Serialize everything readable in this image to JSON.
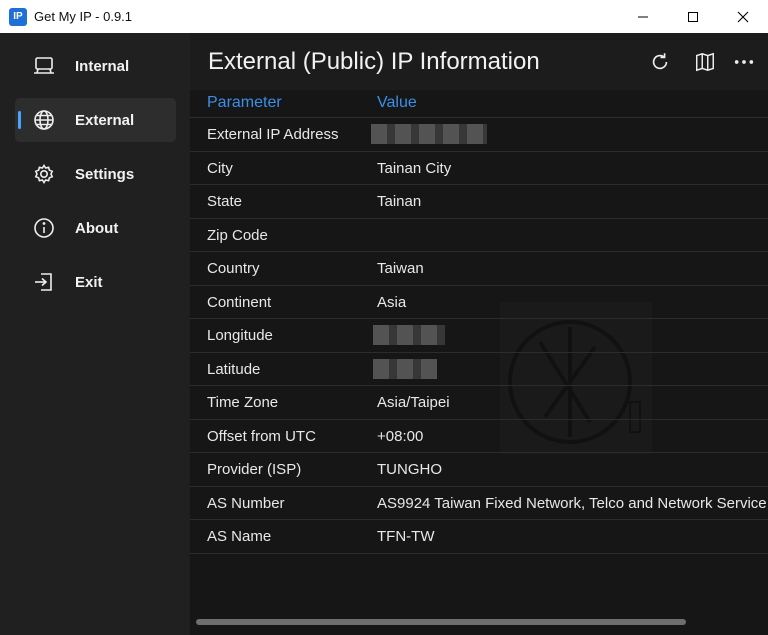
{
  "window": {
    "app_icon_text": "IP",
    "title": "Get My IP - 0.9.1"
  },
  "sidebar": {
    "items": [
      {
        "label": "Internal",
        "icon": "laptop-icon",
        "active": false
      },
      {
        "label": "External",
        "icon": "globe-icon",
        "active": true
      },
      {
        "label": "Settings",
        "icon": "gear-icon",
        "active": false
      },
      {
        "label": "About",
        "icon": "info-icon",
        "active": false
      },
      {
        "label": "Exit",
        "icon": "exit-icon",
        "active": false
      }
    ]
  },
  "main": {
    "title": "External (Public) IP Information",
    "header_icons": [
      "refresh-icon",
      "map-icon",
      "more-icon"
    ],
    "table": {
      "headers": [
        "Parameter",
        "Value"
      ],
      "rows": [
        {
          "param": "External IP Address",
          "value": ""
        },
        {
          "param": "City",
          "value": "Tainan City"
        },
        {
          "param": "State",
          "value": "Tainan"
        },
        {
          "param": "Zip Code",
          "value": ""
        },
        {
          "param": "Country",
          "value": "Taiwan"
        },
        {
          "param": "Continent",
          "value": "Asia"
        },
        {
          "param": "Longitude",
          "value": ""
        },
        {
          "param": "Latitude",
          "value": ""
        },
        {
          "param": "Time Zone",
          "value": "Asia/Taipei"
        },
        {
          "param": "Offset from UTC",
          "value": "+08:00"
        },
        {
          "param": "Provider (ISP)",
          "value": "TUNGHO"
        },
        {
          "param": "AS Number",
          "value": "AS9924 Taiwan Fixed Network, Telco and Network Service"
        },
        {
          "param": "AS Name",
          "value": "TFN-TW"
        }
      ]
    }
  },
  "colors": {
    "accent": "#3a8fe8",
    "sidebar_bg": "#202020",
    "content_bg": "#161616"
  }
}
